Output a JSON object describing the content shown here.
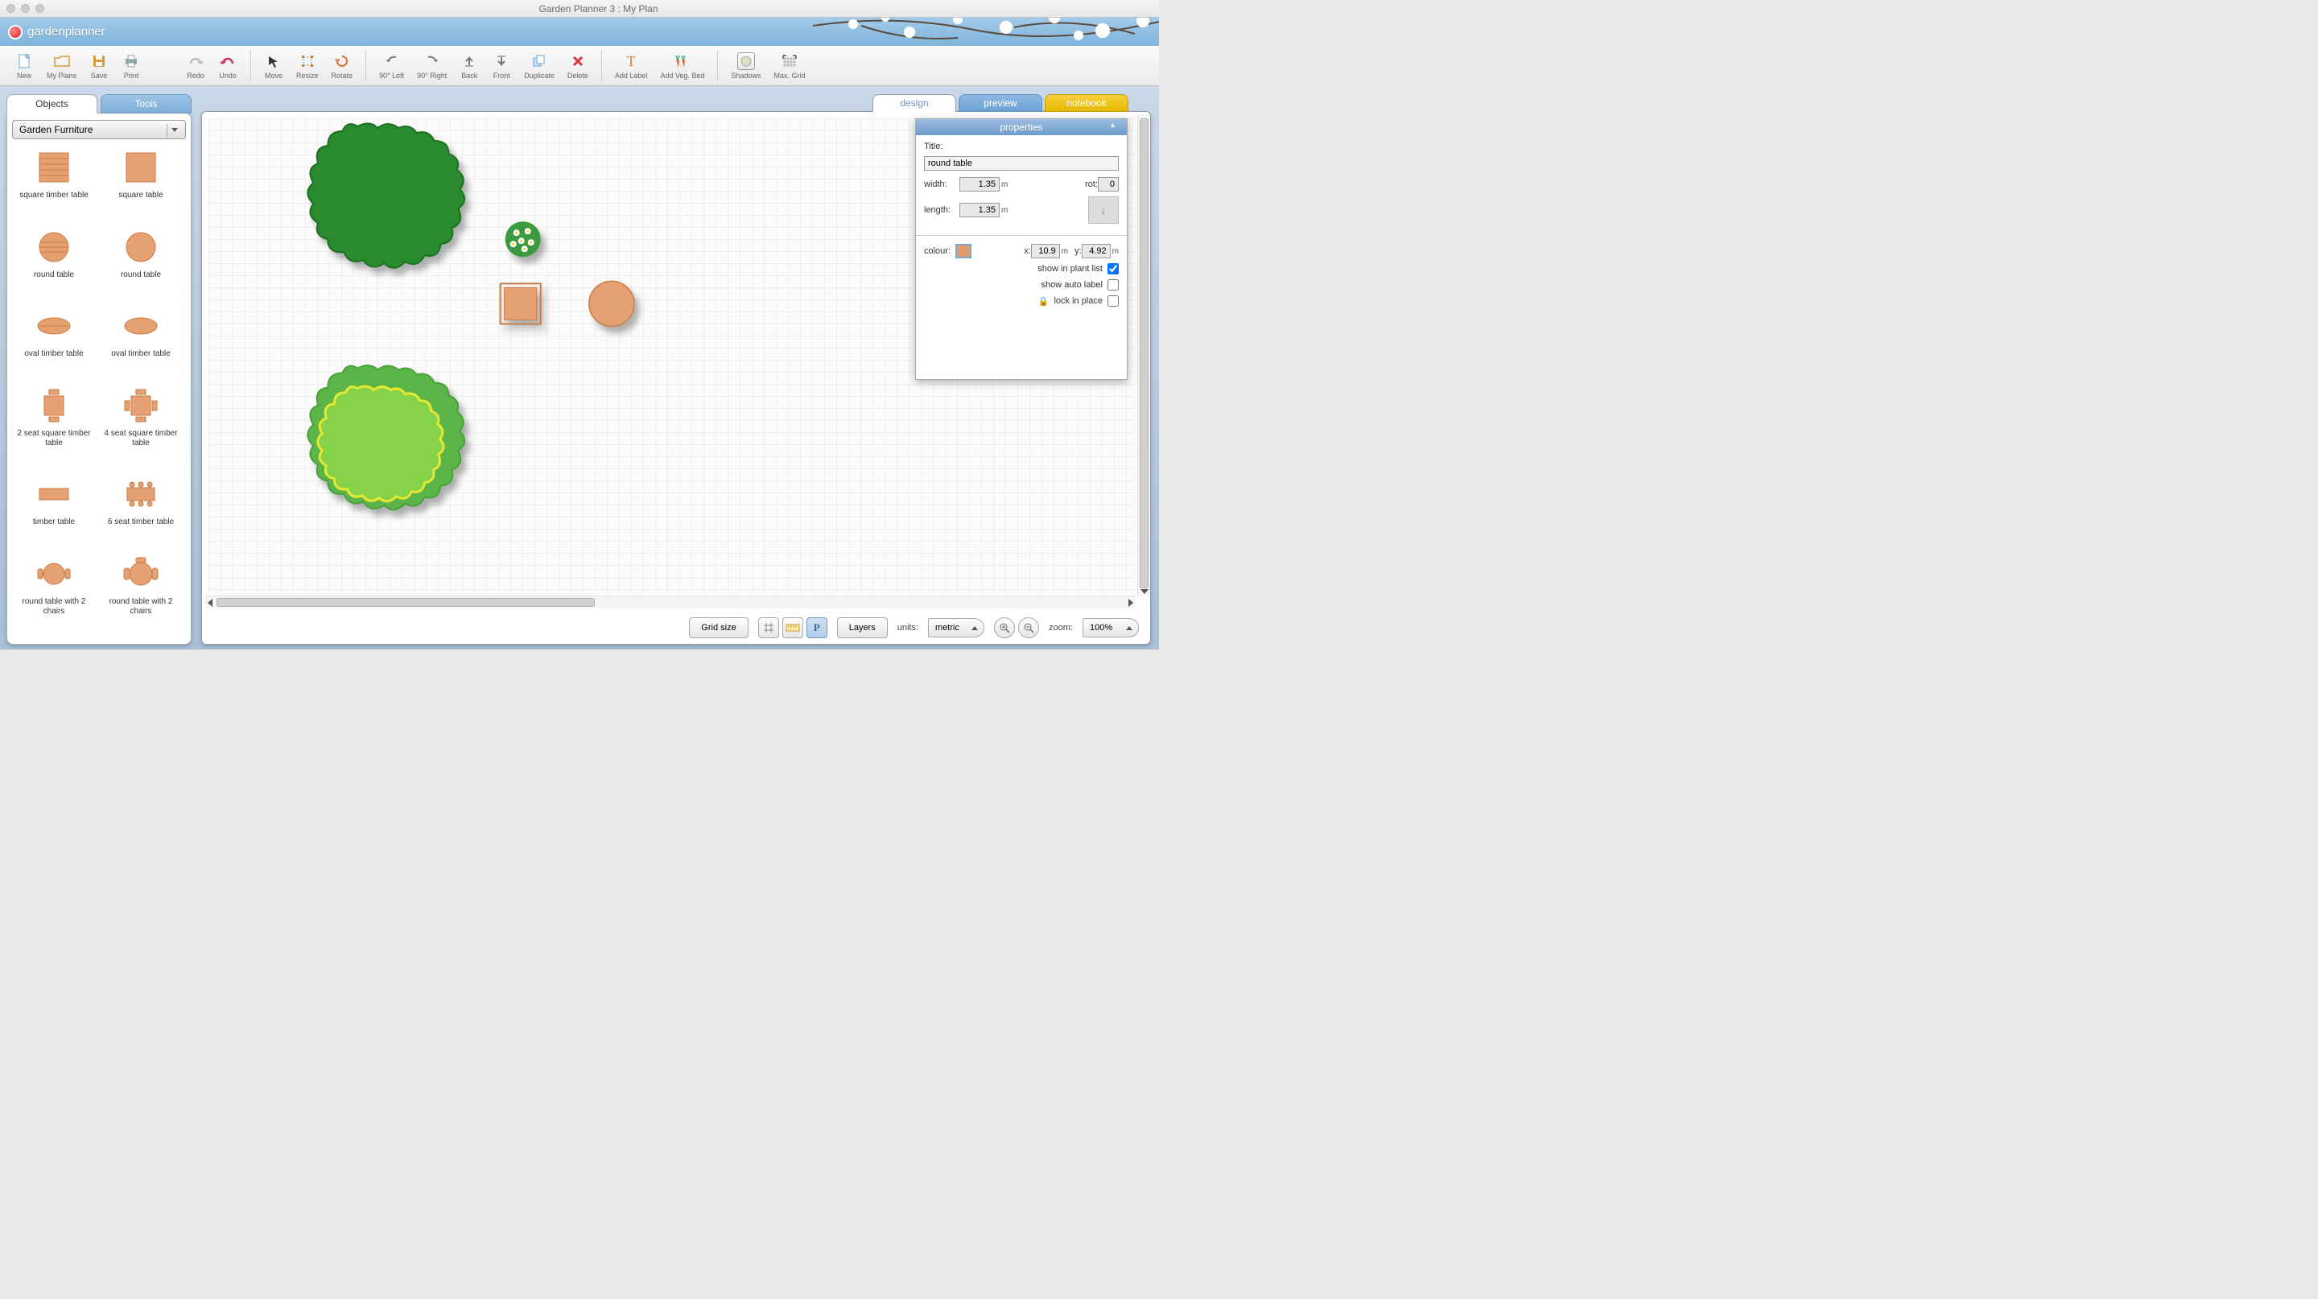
{
  "window": {
    "title": "Garden Planner 3 : My  Plan"
  },
  "brand": {
    "name": "gardenplanner"
  },
  "toolbar": {
    "new": "New",
    "myplans": "My Plans",
    "save": "Save",
    "print": "Print",
    "redo": "Redo",
    "undo": "Undo",
    "move": "Move",
    "resize": "Resize",
    "rotate": "Rotate",
    "rot_left": "90° Left",
    "rot_right": "90° Right",
    "back": "Back",
    "front": "Front",
    "duplicate": "Duplicate",
    "delete": "Delete",
    "add_label": "Add Label",
    "add_veg": "Add Veg. Bed",
    "shadows": "Shadows",
    "max_grid": "Max. Grid"
  },
  "left_tabs": {
    "objects": "Objects",
    "tools": "Tools"
  },
  "category": "Garden Furniture",
  "objects": [
    {
      "name": "square timber table",
      "shape": "sq-slat"
    },
    {
      "name": "square table",
      "shape": "sq"
    },
    {
      "name": "round table",
      "shape": "rd-slat"
    },
    {
      "name": "round table",
      "shape": "rd"
    },
    {
      "name": "oval timber table",
      "shape": "ov-slat"
    },
    {
      "name": "oval timber table",
      "shape": "ov"
    },
    {
      "name": "2 seat square timber table",
      "shape": "sq2"
    },
    {
      "name": "4 seat square timber table",
      "shape": "sq4"
    },
    {
      "name": "timber table",
      "shape": "rect"
    },
    {
      "name": "6 seat timber table",
      "shape": "rect6"
    },
    {
      "name": "round table with 2 chairs",
      "shape": "rd2"
    },
    {
      "name": "round table with 2 chairs",
      "shape": "rd2b"
    }
  ],
  "right_tabs": {
    "design": "design",
    "preview": "preview",
    "notebook": "notebook"
  },
  "properties": {
    "header": "properties",
    "title_label": "Title:",
    "title_value": "round table",
    "width_label": "width:",
    "width_value": "1.35",
    "width_unit": "m",
    "length_label": "length:",
    "length_value": "1.35",
    "length_unit": "m",
    "rot_label": "rot:",
    "rot_value": "0",
    "colour_label": "colour:",
    "colour_value": "#e09a6c",
    "x_label": "x:",
    "x_value": "10.9",
    "x_unit": "m",
    "y_label": "y:",
    "y_value": "4.92",
    "y_unit": "m",
    "show_plant": "show in plant list",
    "show_plant_checked": true,
    "show_auto": "show auto label",
    "show_auto_checked": false,
    "lock": "lock in place",
    "lock_checked": false
  },
  "statusbar": {
    "gridsize": "Grid size",
    "layers": "Layers",
    "units_label": "units:",
    "units_value": "metric",
    "zoom_label": "zoom:",
    "zoom_value": "100%"
  }
}
